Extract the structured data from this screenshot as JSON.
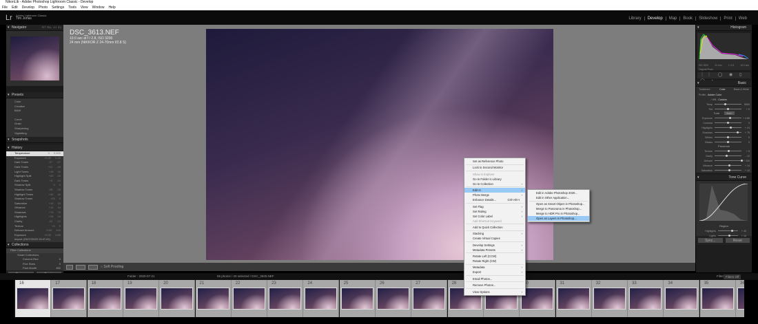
{
  "window": {
    "title": "NikonLib - Adobe Photoshop Lightroom Classic - Develop"
  },
  "menu": [
    "File",
    "Edit",
    "Develop",
    "Photo",
    "Settings",
    "Tools",
    "View",
    "Window",
    "Help"
  ],
  "identity": {
    "logo": "Lr",
    "product": "Adobe Lightroom Classic",
    "user": "Tim Jonas"
  },
  "modules": [
    {
      "label": "Library"
    },
    {
      "label": "Develop",
      "active": true
    },
    {
      "label": "Map"
    },
    {
      "label": "Book"
    },
    {
      "label": "Slideshow"
    },
    {
      "label": "Print"
    },
    {
      "label": "Web"
    }
  ],
  "left": {
    "navigator": {
      "title": "Navigator",
      "zoom": [
        "FIT",
        "FILL",
        "1:1",
        "3:1"
      ]
    },
    "presets": {
      "title": "Presets",
      "items": [
        "Color",
        "Creative",
        "B&W",
        "Curve",
        "Grain",
        "Sharpening",
        "Vignetting"
      ]
    },
    "snapshots": {
      "title": "Snapshots"
    },
    "history": {
      "title": "History",
      "items": [
        {
          "name": "Temperature",
          "a": "0",
          "b": "5,500"
        },
        {
          "name": "Exposure",
          "a": "+0.35",
          "b": "0.35"
        },
        {
          "name": "Dark Tones",
          "a": "-27",
          "b": "-27"
        },
        {
          "name": "Dark Tones",
          "a": "+12",
          "b": "-15"
        },
        {
          "name": "Light Tones",
          "a": "+16",
          "b": "16"
        },
        {
          "name": "Highlight Split",
          "a": "+40",
          "b": "40"
        },
        {
          "name": "Dark Tones",
          "a": "+5",
          "b": "-10"
        },
        {
          "name": "Shadow Split",
          "a": "0",
          "b": "0"
        },
        {
          "name": "Shadow Tones",
          "a": "-25",
          "b": "-25"
        },
        {
          "name": "Highlight Tones",
          "a": "+40",
          "b": "40"
        },
        {
          "name": "Shadow Tones",
          "a": "+25",
          "b": "0"
        },
        {
          "name": "Saturation",
          "a": "+10",
          "b": "10"
        },
        {
          "name": "Vibrance",
          "a": "+14",
          "b": "14"
        },
        {
          "name": "Shadows",
          "a": "+75",
          "b": "75"
        },
        {
          "name": "Highlights",
          "a": "+24",
          "b": "24"
        },
        {
          "name": "Clarity",
          "a": "-12",
          "b": "-12"
        },
        {
          "name": "Texture",
          "a": "+5",
          "b": "5"
        },
        {
          "name": "Dehaze Amount",
          "a": "+100",
          "b": "100"
        },
        {
          "name": "Exposure",
          "a": "+0.00",
          "b": "0.85"
        },
        {
          "name": "Import (23/07/2020 13:47:41)",
          "a": "",
          "b": ""
        }
      ]
    },
    "collections": {
      "title": "Collections",
      "filter": "Filter Collections",
      "items": [
        {
          "name": "Smart Collections",
          "count": ""
        },
        {
          "name": "Colored Red",
          "count": "0"
        },
        {
          "name": "Five Stars",
          "count": "0"
        },
        {
          "name": "Past Month",
          "count": "452"
        }
      ]
    },
    "copy": "Copy...",
    "paste": "Paste"
  },
  "photo": {
    "filename": "DSC_3613.NEF",
    "line1": "10.0 sec at f / 2.8, ISO 3200",
    "line2": "24 mm (NIKKOR Z 24-70mm f/2.8 S)"
  },
  "toolbar": {
    "soft_proofing": "Soft Proofing"
  },
  "right": {
    "histogram": {
      "title": "Histogram",
      "iso": "ISO 3200",
      "focal": "24 mm",
      "aperture": "f / 2.8",
      "shutter": "10.0 sec",
      "original": "Original Photo"
    },
    "basic": {
      "title": "Basic",
      "treatment_label": "Treatment :",
      "color": "Color",
      "bw": "Black & White",
      "profile_label": "Profile :",
      "profile": "Adobe Color",
      "wb_label": "WB :",
      "wb": "Custom",
      "tone": "Tone",
      "auto": "Auto",
      "presence": "Presence",
      "sliders": [
        {
          "label": "Temp",
          "value": "5500",
          "pos": 0.4
        },
        {
          "label": "Tint",
          "value": "+ 0",
          "pos": 0.5
        },
        {
          "label": "Exposure",
          "value": "+ 0.85",
          "pos": 0.57
        },
        {
          "label": "Contrast",
          "value": "0",
          "pos": 0.5
        },
        {
          "label": "Highlights",
          "value": "+ 24",
          "pos": 0.6
        },
        {
          "label": "Shadows",
          "value": "+ 75",
          "pos": 0.85
        },
        {
          "label": "Whites",
          "value": "0",
          "pos": 0.5
        },
        {
          "label": "Blacks",
          "value": "0",
          "pos": 0.5
        },
        {
          "label": "Texture",
          "value": "+ 5",
          "pos": 0.52
        },
        {
          "label": "Clarity",
          "value": "- 12",
          "pos": 0.44
        },
        {
          "label": "Dehaze",
          "value": "+ 100",
          "pos": 1.0
        },
        {
          "label": "Vibrance",
          "value": "+ 14",
          "pos": 0.56
        },
        {
          "label": "Saturation",
          "value": "+ 10",
          "pos": 0.55
        }
      ]
    },
    "tone_curve": {
      "title": "Tone Curve",
      "region": "Region",
      "sliders": [
        {
          "label": "Highlights",
          "value": "+ 40",
          "pos": 0.7
        },
        {
          "label": "Lights",
          "value": "+ 16",
          "pos": 0.58
        }
      ]
    },
    "sync": "Sync...",
    "reset": "Reset"
  },
  "filmstrip": {
    "source": "Folder : 2020-07-21",
    "status": "55 photos / 20 selected / DSC_3625.NEF",
    "filter_label": "Filter :",
    "filter": "Filters Off",
    "cells": [
      "16",
      "17",
      "18",
      "19",
      "20",
      "21",
      "22",
      "23",
      "24",
      "25",
      "26",
      "27",
      "28",
      "29",
      "30",
      "31",
      "32",
      "33",
      "34",
      "35",
      "36"
    ]
  },
  "context_menu": {
    "items": [
      {
        "label": "Set as Reference Photo"
      },
      {
        "sep": true
      },
      {
        "label": "Lock to Second Monitor"
      },
      {
        "sep": true
      },
      {
        "label": "Show in Explorer",
        "disabled": true
      },
      {
        "label": "Go to Folder in Library"
      },
      {
        "label": "Go to Collection",
        "arrow": true
      },
      {
        "sep": true
      },
      {
        "label": "Edit In",
        "arrow": true,
        "highlight": true
      },
      {
        "label": "Photo Merge",
        "arrow": true
      },
      {
        "label": "Enhance Details...",
        "shortcut": "Ctrl+Alt+I"
      },
      {
        "sep": true
      },
      {
        "label": "Set Flag",
        "arrow": true
      },
      {
        "label": "Set Rating",
        "arrow": true
      },
      {
        "label": "Set Color Label",
        "arrow": true
      },
      {
        "label": "Add Shortcut Keyword",
        "disabled": true
      },
      {
        "sep": true
      },
      {
        "label": "Add to Quick Collection"
      },
      {
        "sep": true
      },
      {
        "label": "Stacking",
        "arrow": true
      },
      {
        "label": "Create Virtual Copies"
      },
      {
        "sep": true
      },
      {
        "label": "Develop Settings",
        "arrow": true
      },
      {
        "label": "Metadata Presets",
        "arrow": true
      },
      {
        "sep": true
      },
      {
        "label": "Rotate Left (CCW)"
      },
      {
        "label": "Rotate Right (CW)"
      },
      {
        "sep": true
      },
      {
        "label": "Metadata",
        "arrow": true
      },
      {
        "label": "Export",
        "arrow": true
      },
      {
        "sep": true
      },
      {
        "label": "Email Photos..."
      },
      {
        "sep": true
      },
      {
        "label": "Remove Photos..."
      },
      {
        "sep": true
      },
      {
        "label": "View Options",
        "arrow": true
      }
    ]
  },
  "submenu": {
    "items": [
      {
        "label": "Edit in Adobe Photoshop 2020..."
      },
      {
        "label": "Edit in Other Application..."
      },
      {
        "sep": true
      },
      {
        "label": "Open as Smart Object in Photoshop..."
      },
      {
        "label": "Merge to Panorama in Photoshop..."
      },
      {
        "label": "Merge to HDR Pro in Photoshop..."
      },
      {
        "label": "Open as Layers in Photoshop...",
        "highlight": true
      }
    ]
  }
}
